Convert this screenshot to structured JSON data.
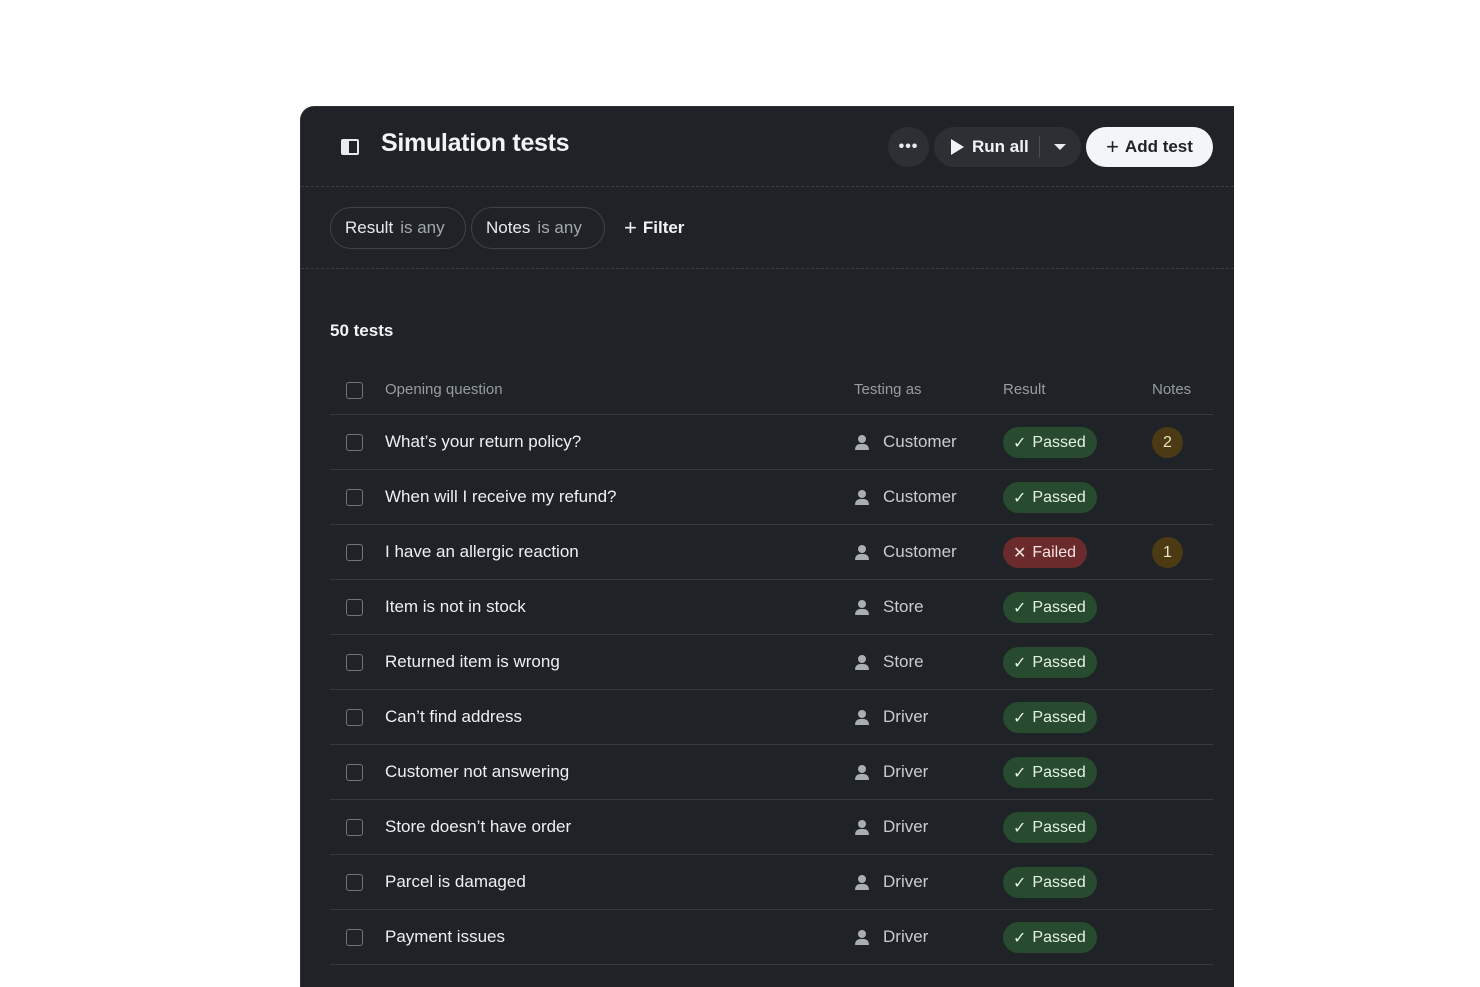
{
  "header": {
    "title": "Simulation tests",
    "more_label": "•••",
    "run_all_label": "Run all",
    "add_test_label": "Add test"
  },
  "filters": {
    "result": {
      "field": "Result",
      "op": "is any"
    },
    "notes": {
      "field": "Notes",
      "op": "is any"
    },
    "add_filter_label": "Filter"
  },
  "summary": {
    "count_label": "50 tests"
  },
  "table": {
    "columns": {
      "question": "Opening question",
      "testing_as": "Testing as",
      "result": "Result",
      "notes": "Notes"
    },
    "rows": [
      {
        "question": "What’s your return policy?",
        "testing_as": "Customer",
        "result": "Passed",
        "status": "passed",
        "notes": "2"
      },
      {
        "question": "When will I receive my refund?",
        "testing_as": "Customer",
        "result": "Passed",
        "status": "passed",
        "notes": ""
      },
      {
        "question": "I have an allergic reaction",
        "testing_as": "Customer",
        "result": "Failed",
        "status": "failed",
        "notes": "1"
      },
      {
        "question": "Item is not in stock",
        "testing_as": "Store",
        "result": "Passed",
        "status": "passed",
        "notes": ""
      },
      {
        "question": "Returned item is wrong",
        "testing_as": "Store",
        "result": "Passed",
        "status": "passed",
        "notes": ""
      },
      {
        "question": "Can’t find address",
        "testing_as": "Driver",
        "result": "Passed",
        "status": "passed",
        "notes": ""
      },
      {
        "question": "Customer not answering",
        "testing_as": "Driver",
        "result": "Passed",
        "status": "passed",
        "notes": ""
      },
      {
        "question": "Store doesn’t have order",
        "testing_as": "Driver",
        "result": "Passed",
        "status": "passed",
        "notes": ""
      },
      {
        "question": "Parcel is damaged",
        "testing_as": "Driver",
        "result": "Passed",
        "status": "passed",
        "notes": ""
      },
      {
        "question": "Payment issues",
        "testing_as": "Driver",
        "result": "Passed",
        "status": "passed",
        "notes": ""
      }
    ]
  },
  "colors": {
    "panel_bg": "#1f2226",
    "passed_bg": "#284a2e",
    "failed_bg": "#6b2a2c",
    "notes_bg": "#4b3a14"
  },
  "icons": {
    "sidebar": "sidebar-toggle-icon",
    "more": "more-horizontal-icon",
    "run": "play-icon",
    "dropdown": "chevron-down-icon",
    "add": "plus-icon",
    "person": "person-icon",
    "passed": "check-icon",
    "failed": "x-icon"
  }
}
